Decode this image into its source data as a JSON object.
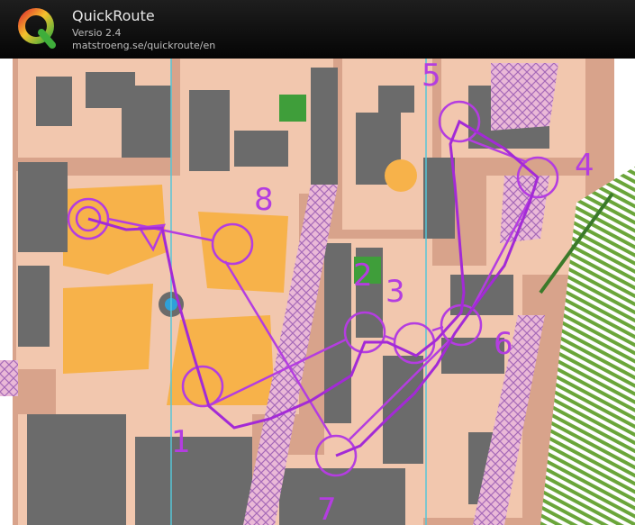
{
  "header": {
    "title": "QuickRoute",
    "version": "Versio 2.4",
    "url": "matstroeng.se/quickroute/en"
  },
  "map": {
    "control_labels": [
      "1",
      "2",
      "3",
      "4",
      "5",
      "6",
      "7",
      "8"
    ]
  },
  "colors": {
    "course": "#b43de0",
    "route": "#a32ad6",
    "building": "#6b6b6b",
    "paved": "#f2c7ae",
    "open": "#f7b24a",
    "road": "#d7a58d"
  }
}
